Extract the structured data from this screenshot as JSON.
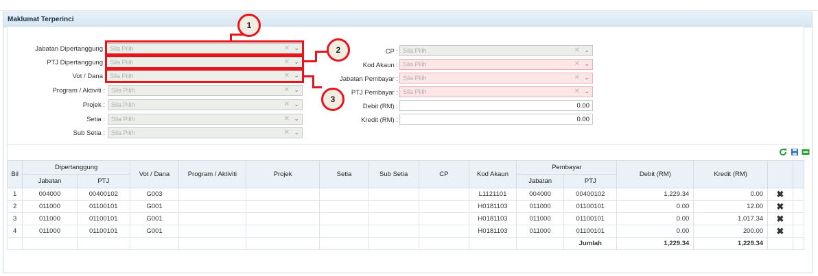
{
  "panel": {
    "title": "Maklumat Terperinci"
  },
  "form": {
    "left": [
      {
        "label": "Jabatan Dipertanggung",
        "placeholder": "Sila Pilih"
      },
      {
        "label": "PTJ Dipertanggung",
        "placeholder": "Sila Pilih"
      },
      {
        "label": "Vot / Dana",
        "placeholder": "Sila Pilih"
      },
      {
        "label": "Program / Aktiviti :",
        "placeholder": "Sila Pilih"
      },
      {
        "label": "Projek :",
        "placeholder": "Sila Pilih"
      },
      {
        "label": "Setia :",
        "placeholder": "Sila Pilih"
      },
      {
        "label": "Sub Setia :",
        "placeholder": "Sila Pilih"
      }
    ],
    "right": [
      {
        "label": "CP :",
        "placeholder": "Sila Pilih"
      },
      {
        "label": "Kod Akaun :",
        "placeholder": "Sila Pilih"
      },
      {
        "label": "Jabatan Pembayar :",
        "placeholder": "Sila Pilih"
      },
      {
        "label": "PTJ Pembayar :",
        "placeholder": "Sila Pilih"
      }
    ],
    "debit": {
      "label": "Debit (RM) :",
      "value": "0.00"
    },
    "kredit": {
      "label": "Kredit (RM) :",
      "value": "0.00"
    },
    "clear_glyph": "✕",
    "dropdown_glyph": "⌄"
  },
  "callouts": [
    "1",
    "2",
    "3"
  ],
  "toolbar": {
    "refresh_icon": "refresh-icon",
    "save_icon": "save-icon",
    "add_icon": "add-row-icon"
  },
  "table": {
    "headers": {
      "bil": "Bil",
      "dipertanggung": "Dipertanggung",
      "jabatan": "Jabatan",
      "ptj": "PTJ",
      "vot": "Vot / Dana",
      "program": "Program / Aktiviti",
      "projek": "Projek",
      "setia": "Setia",
      "subsetia": "Sub Setia",
      "cp": "CP",
      "kod": "Kod Akaun",
      "pembayar": "Pembayar",
      "pjabatan": "Jabatan",
      "pptj": "PTJ",
      "debit": "Debit (RM)",
      "kredit": "Kredit (RM)"
    },
    "rows": [
      {
        "bil": "1",
        "jabatan": "004000",
        "ptj": "00400102",
        "vot": "G003",
        "kod": "L1121101",
        "pjabatan": "004000",
        "pptj": "00400102",
        "debit": "1,229.34",
        "kredit": "0.00"
      },
      {
        "bil": "2",
        "jabatan": "011000",
        "ptj": "01100101",
        "vot": "G001",
        "kod": "H0181103",
        "pjabatan": "011000",
        "pptj": "01100101",
        "debit": "0.00",
        "kredit": "12.00"
      },
      {
        "bil": "3",
        "jabatan": "011000",
        "ptj": "01100101",
        "vot": "G001",
        "kod": "H0181103",
        "pjabatan": "011000",
        "pptj": "01100101",
        "debit": "0.00",
        "kredit": "1,017.34"
      },
      {
        "bil": "4",
        "jabatan": "011000",
        "ptj": "01100101",
        "vot": "G001",
        "kod": "H0181103",
        "pjabatan": "011000",
        "pptj": "01100101",
        "debit": "0.00",
        "kredit": "200.00"
      }
    ],
    "delete_glyph": "✖",
    "total": {
      "label": "Jumlah",
      "debit": "1,229.34",
      "kredit": "1,229.34"
    }
  }
}
